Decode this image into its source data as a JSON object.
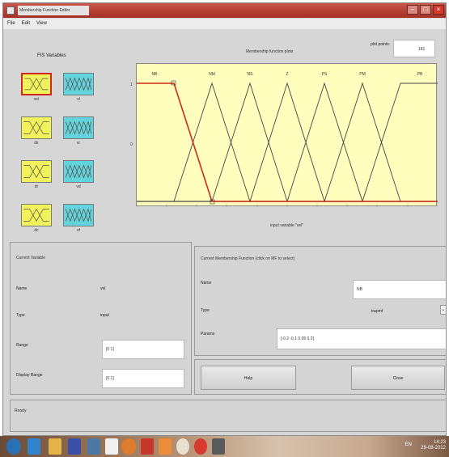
{
  "window": {
    "title": "Membership Function Editor",
    "minimize_label": "–",
    "maximize_label": "□",
    "close_label": "×"
  },
  "menu": {
    "items": [
      "File",
      "Edit",
      "View"
    ]
  },
  "fis_variables": {
    "label": "FIS Variables",
    "inputs": [
      "vel",
      "dir",
      "dr",
      "dc"
    ],
    "outputs": [
      "vl",
      "vr",
      "vd",
      "vf"
    ]
  },
  "range_control": {
    "label": "plot points:",
    "value": "181"
  },
  "plot": {
    "title": "Membership function plots",
    "x_label": "input variable \"vel\"",
    "y_tick_top": "1",
    "y_tick_bottom": "0",
    "mf_labels": [
      "NB",
      "NM",
      "NS",
      "Z",
      "PS",
      "PM",
      "PB"
    ]
  },
  "current_variable": {
    "title": "Current Variable",
    "name_label": "Name",
    "name_value": "vel",
    "type_label": "Type",
    "type_value": "input",
    "range_label": "Range",
    "range_value": "[0 1]",
    "display_range_label": "Display Range",
    "display_range_value": "[0 1]"
  },
  "current_mf": {
    "title": "Current Membership Function (click on MF to select)",
    "name_label": "Name",
    "name_value": "NB",
    "type_label": "Type",
    "type_value": "trapmf",
    "params_label": "Params",
    "params_value": "[-0.2 -0.1 0.05 0.2]"
  },
  "buttons": {
    "help": "Help",
    "close": "Close"
  },
  "status": {
    "text": "Ready"
  },
  "taskbar": {
    "time": "14:23",
    "date": "29-08-2012",
    "lang": "EN"
  },
  "colors": {
    "titlebar": "#b43a2f",
    "input_mf": "#f2f25a",
    "output_mf": "#63d4dc",
    "plot_bg": "#fffebd",
    "selected_mf": "#d0281a"
  }
}
